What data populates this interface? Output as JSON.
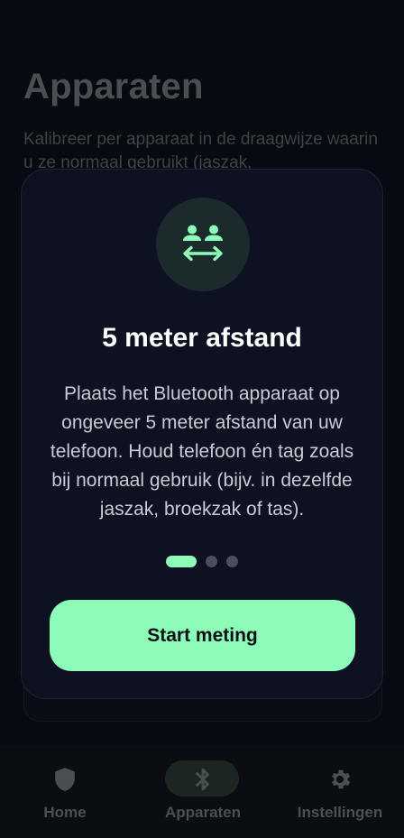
{
  "page": {
    "title": "Apparaten",
    "subtitle": "Kalibreer per apparaat in de draagwijze waarin u ze normaal gebruikt (jaszak,"
  },
  "modal": {
    "icon": "people-distance-icon",
    "title": "5 meter afstand",
    "body": "Plaats het Bluetooth apparaat op ongeveer 5 meter afstand van uw telefoon. Houd telefoon én tag zoals bij normaal gebruik (bijv. in dezelfde jaszak, broekzak of tas).",
    "step_current": 1,
    "step_total": 3,
    "button_label": "Start meting"
  },
  "nav": {
    "items": [
      {
        "label": "Home",
        "icon": "shield-icon",
        "active": false
      },
      {
        "label": "Apparaten",
        "icon": "bluetooth-icon",
        "active": true
      },
      {
        "label": "Instellingen",
        "icon": "gear-icon",
        "active": false
      }
    ]
  },
  "colors": {
    "accent": "#8cfcb8",
    "modal_bg": "#0d1121",
    "background": "#070a10",
    "icon_circle": "#1b2b2c"
  }
}
